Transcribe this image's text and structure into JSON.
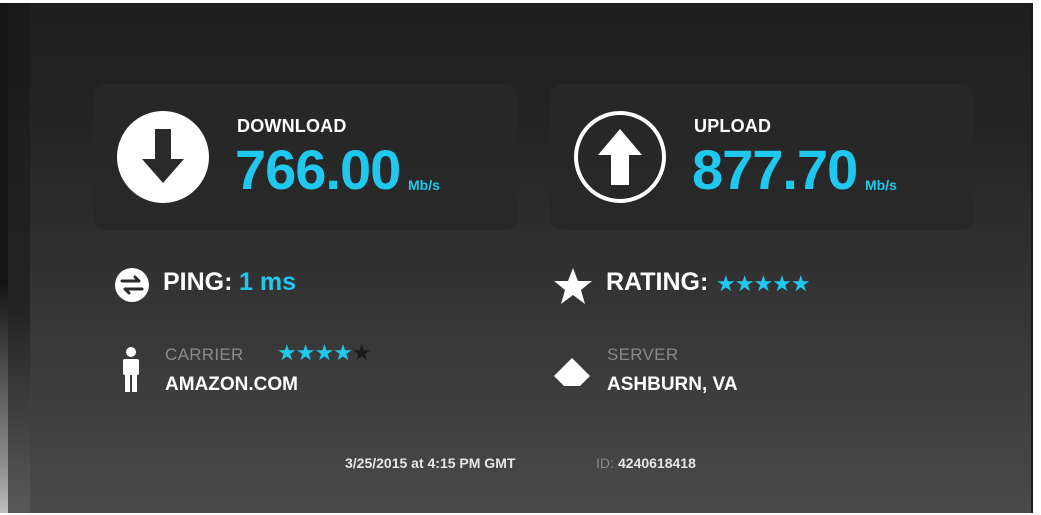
{
  "download": {
    "label": "DOWNLOAD",
    "value": "766.00",
    "unit": "Mb/s",
    "icon": "arrow-down-circle-icon"
  },
  "upload": {
    "label": "UPLOAD",
    "value": "877.70",
    "unit": "Mb/s",
    "icon": "arrow-up-circle-icon"
  },
  "ping": {
    "label": "PING:",
    "value": "1 ms",
    "icon": "ping-arrows-icon"
  },
  "rating": {
    "label": "RATING:",
    "stars": "★★★★★",
    "stars_filled": 5,
    "stars_total": 5,
    "icon": "star-icon"
  },
  "carrier": {
    "label": "CARRIER",
    "value": "AMAZON.COM",
    "stars_on": "★★★★",
    "stars_off": "★",
    "stars_filled": 4,
    "stars_total": 5,
    "icon": "person-icon"
  },
  "server": {
    "label": "SERVER",
    "value": "ASHBURN, VA",
    "icon": "server-marker-icon"
  },
  "footer": {
    "date": "3/25/2015 at 4:15 PM GMT",
    "id_label": "ID:",
    "id_value": "4240618418"
  },
  "colors": {
    "accent": "#1fc8ee",
    "text": "#ffffff",
    "muted": "#8a8a8a",
    "panel": "#282828"
  }
}
